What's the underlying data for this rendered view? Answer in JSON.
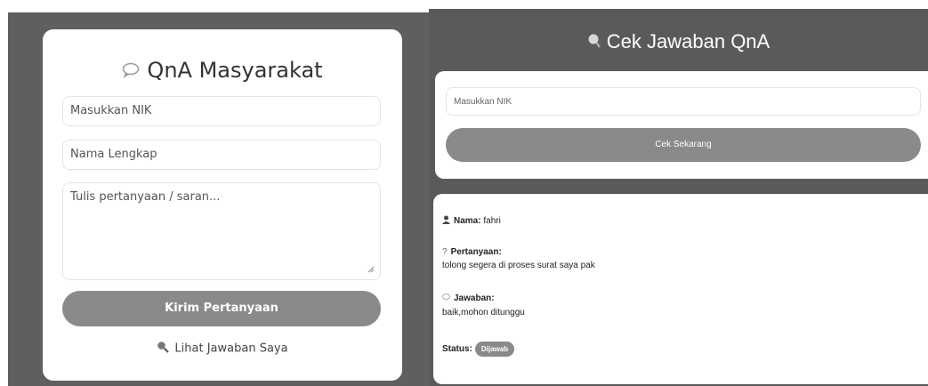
{
  "qna": {
    "title": "QnA Masyarakat",
    "nik_placeholder": "Masukkan NIK",
    "name_placeholder": "Nama Lengkap",
    "question_placeholder": "Tulis pertanyaan / saran...",
    "submit_label": "Kirim Pertanyaan",
    "view_answers_label": "Lihat Jawaban Saya"
  },
  "check": {
    "title": "Cek Jawaban QnA",
    "nik_placeholder": "Masukkan NIK",
    "button_label": "Cek Sekarang"
  },
  "result": {
    "name_label": "Nama:",
    "name_value": "fahri",
    "question_label": "Pertanyaan:",
    "question_value": "tolong segera di proses surat saya pak",
    "answer_label": "Jawaban:",
    "answer_value": "baik,mohon ditunggu",
    "status_label": "Status:",
    "status_value": "Dijawab"
  },
  "icons": {
    "qna_title": "speech-bubble-icon",
    "view_answers": "magnifier-icon",
    "check_title": "magnifier-icon",
    "name": "user-icon",
    "question": "question-icon",
    "answer": "speech-bubble-icon"
  },
  "colors": {
    "background_dark": "#5a5a5a",
    "button": "#8a8a8a",
    "card": "#ffffff"
  }
}
